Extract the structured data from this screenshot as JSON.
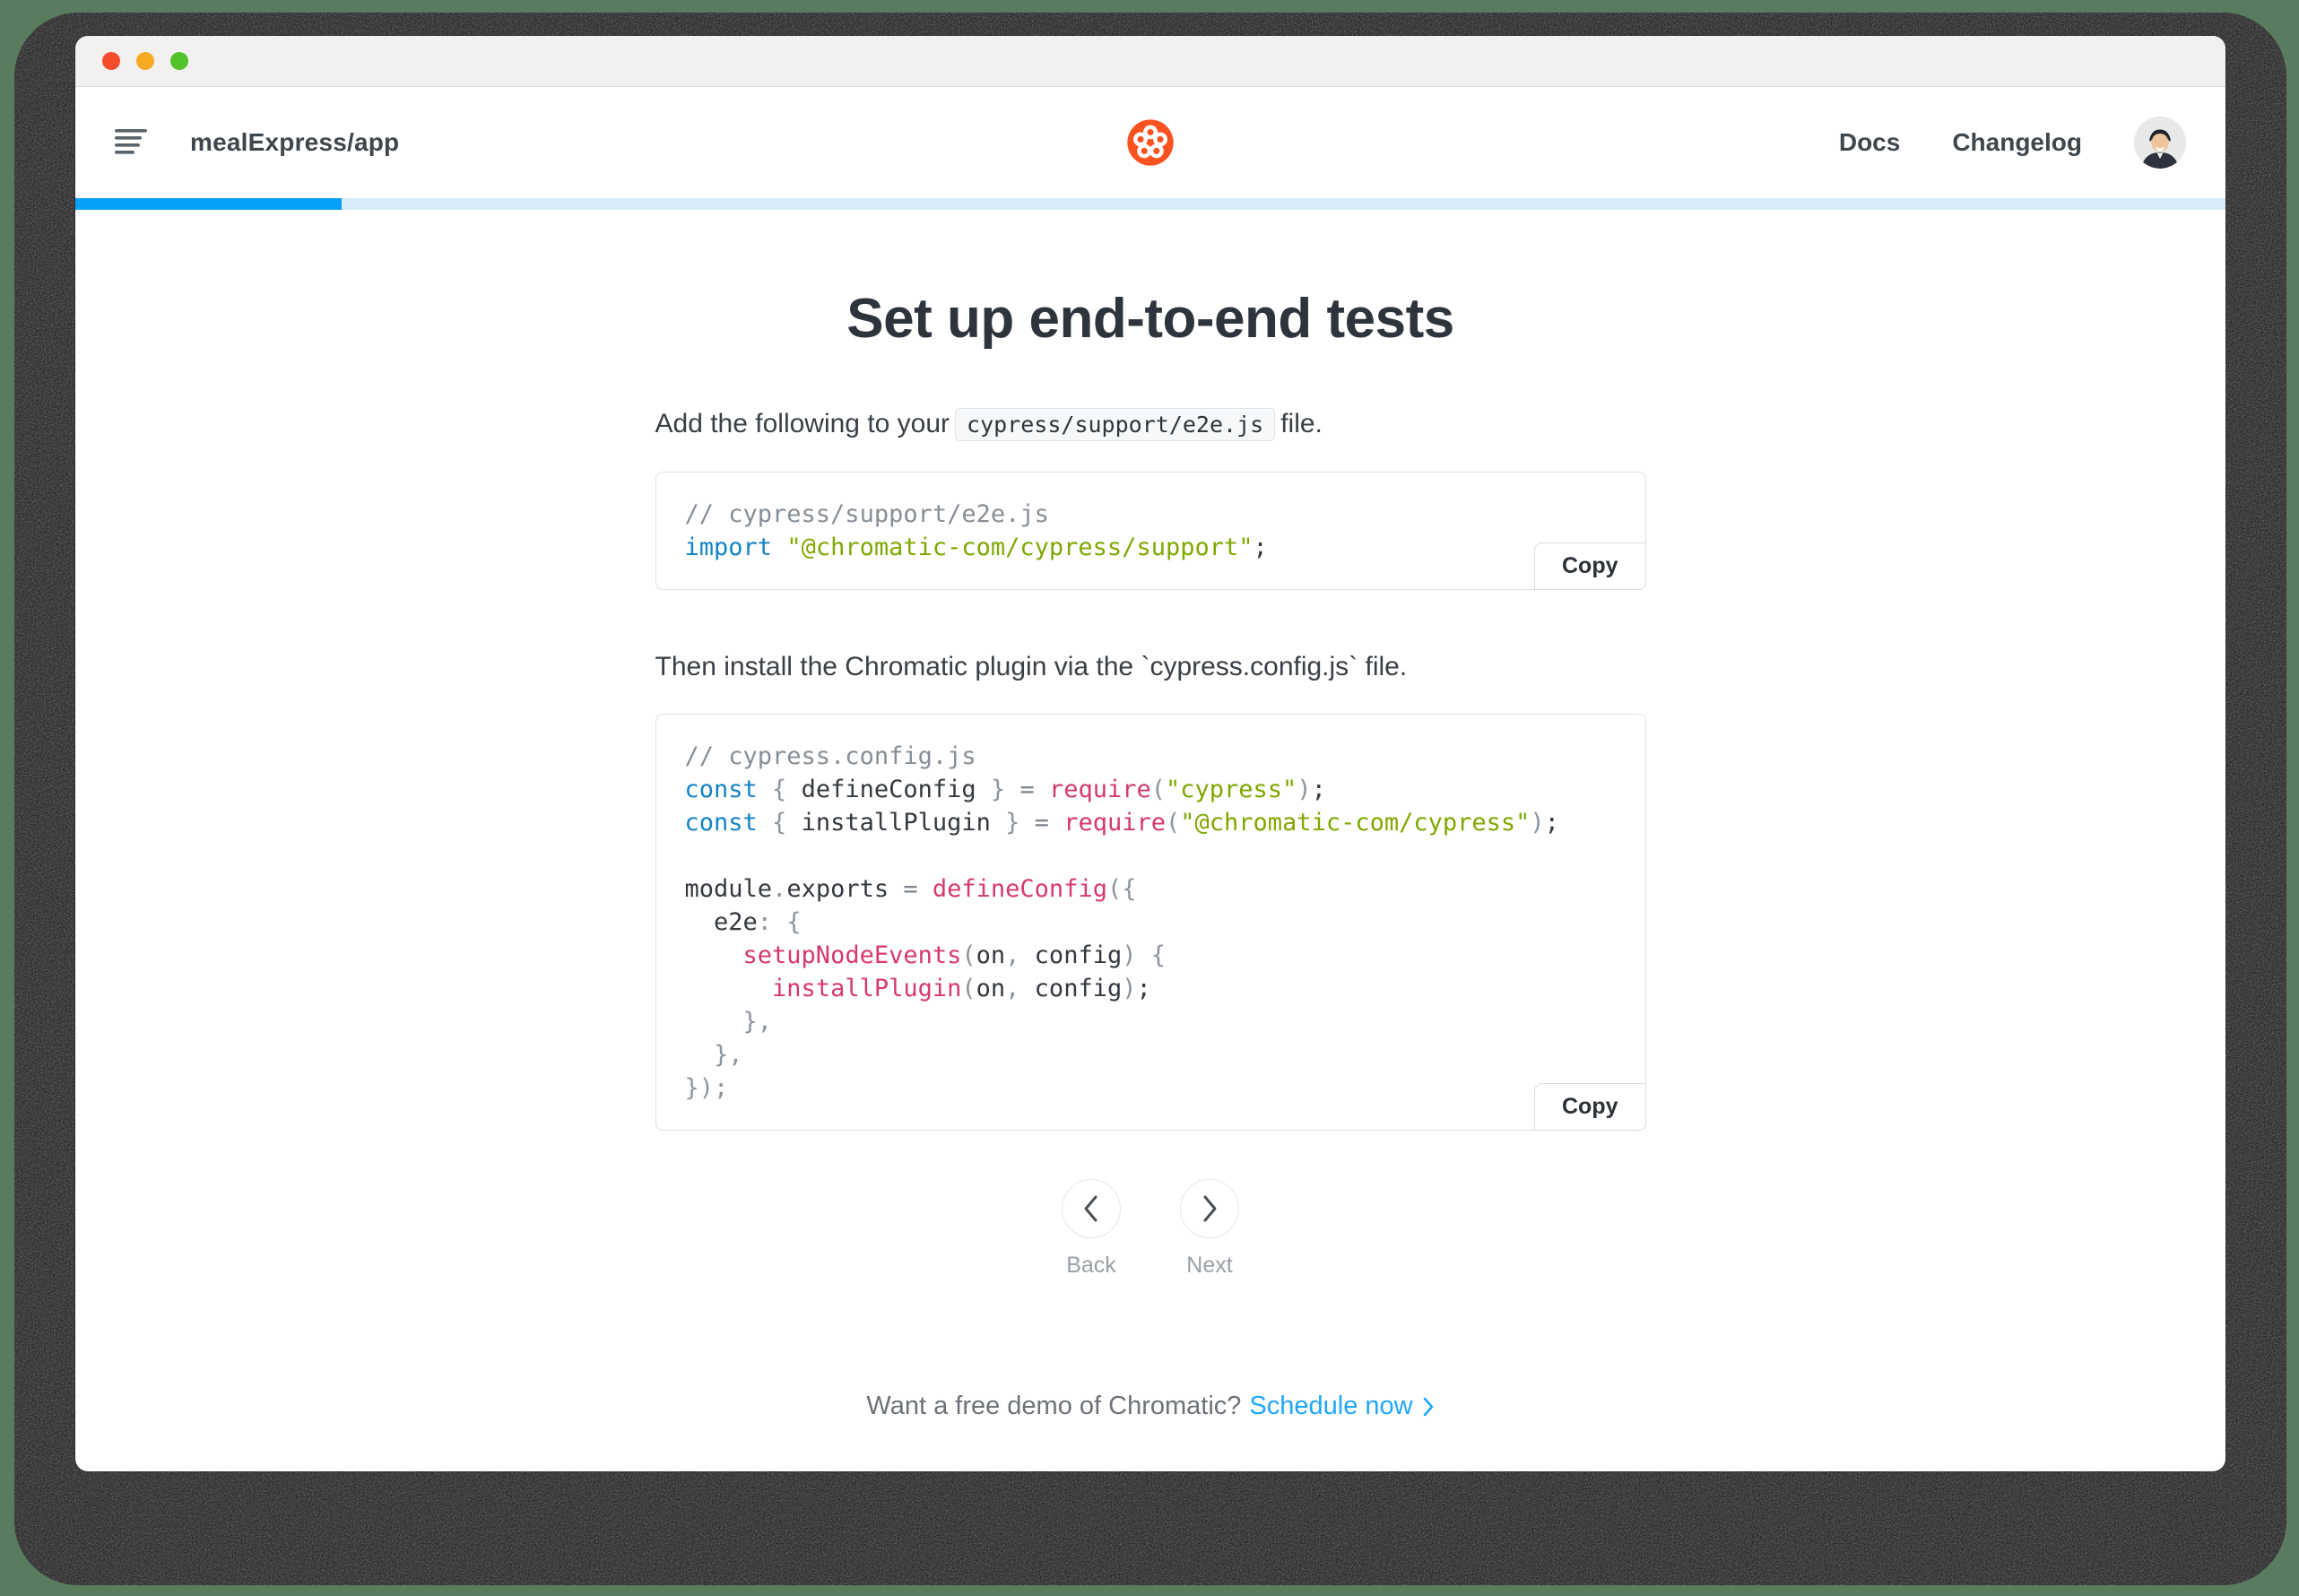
{
  "header": {
    "project_name": "mealExpress/app",
    "nav": [
      {
        "label": "Docs"
      },
      {
        "label": "Changelog"
      }
    ]
  },
  "progress": {
    "percent": 12.4,
    "fill_color": "#06a0f9",
    "track_color": "#d8ecfb"
  },
  "content": {
    "title": "Set up end-to-end tests",
    "step1": {
      "prefix": "Add the following to your",
      "code": "cypress/support/e2e.js",
      "suffix": "file."
    },
    "code_block_1": {
      "lines": [
        [
          [
            "c",
            "// cypress/support/e2e.js"
          ]
        ],
        [
          [
            "k",
            "import"
          ],
          [
            "t",
            " "
          ],
          [
            "s",
            "\"@chromatic-com/cypress/support\""
          ],
          [
            "t",
            ";"
          ]
        ]
      ]
    },
    "step2": "Then install the Chromatic plugin via the `cypress.config.js` file.",
    "code_block_2": {
      "lines": [
        [
          [
            "c",
            "// cypress.config.js"
          ]
        ],
        [
          [
            "k",
            "const"
          ],
          [
            "t",
            " "
          ],
          [
            "p",
            "{"
          ],
          [
            "t",
            " defineConfig "
          ],
          [
            "p",
            "}"
          ],
          [
            "o",
            " = "
          ],
          [
            "f",
            "require"
          ],
          [
            "p",
            "("
          ],
          [
            "s",
            "\"cypress\""
          ],
          [
            "p",
            ")"
          ],
          [
            "t",
            ";"
          ]
        ],
        [
          [
            "k",
            "const"
          ],
          [
            "t",
            " "
          ],
          [
            "p",
            "{"
          ],
          [
            "t",
            " installPlugin "
          ],
          [
            "p",
            "}"
          ],
          [
            "o",
            " = "
          ],
          [
            "f",
            "require"
          ],
          [
            "p",
            "("
          ],
          [
            "s",
            "\"@chromatic-com/cypress\""
          ],
          [
            "p",
            ")"
          ],
          [
            "t",
            ";"
          ]
        ],
        [],
        [
          [
            "t",
            "module"
          ],
          [
            "p",
            "."
          ],
          [
            "t",
            "exports"
          ],
          [
            "o",
            " = "
          ],
          [
            "f",
            "defineConfig"
          ],
          [
            "p",
            "({"
          ]
        ],
        [
          [
            "t",
            "  e2e"
          ],
          [
            "p",
            ":"
          ],
          [
            "t",
            " "
          ],
          [
            "p",
            "{"
          ]
        ],
        [
          [
            "t",
            "    "
          ],
          [
            "f",
            "setupNodeEvents"
          ],
          [
            "p",
            "("
          ],
          [
            "t",
            "on"
          ],
          [
            "p",
            ","
          ],
          [
            "t",
            " config"
          ],
          [
            "p",
            ")"
          ],
          [
            "t",
            " "
          ],
          [
            "p",
            "{"
          ]
        ],
        [
          [
            "t",
            "      "
          ],
          [
            "f",
            "installPlugin"
          ],
          [
            "p",
            "("
          ],
          [
            "t",
            "on"
          ],
          [
            "p",
            ","
          ],
          [
            "t",
            " config"
          ],
          [
            "p",
            ")"
          ],
          [
            "t",
            ";"
          ]
        ],
        [
          [
            "t",
            "    "
          ],
          [
            "p",
            "},"
          ]
        ],
        [
          [
            "t",
            "  "
          ],
          [
            "p",
            "},"
          ]
        ],
        [
          [
            "p",
            "});"
          ]
        ]
      ]
    },
    "copy_label": "Copy",
    "pager": {
      "back": "Back",
      "next": "Next"
    }
  },
  "footer": {
    "question": "Want a free demo of Chromatic?",
    "link": "Schedule now"
  },
  "colors": {
    "logo_orange": "#fc521f",
    "link_blue": "#1ea7fd",
    "keyword_blue": "#1484c6",
    "string_green": "#7fa800",
    "function_pink": "#d6396b"
  }
}
